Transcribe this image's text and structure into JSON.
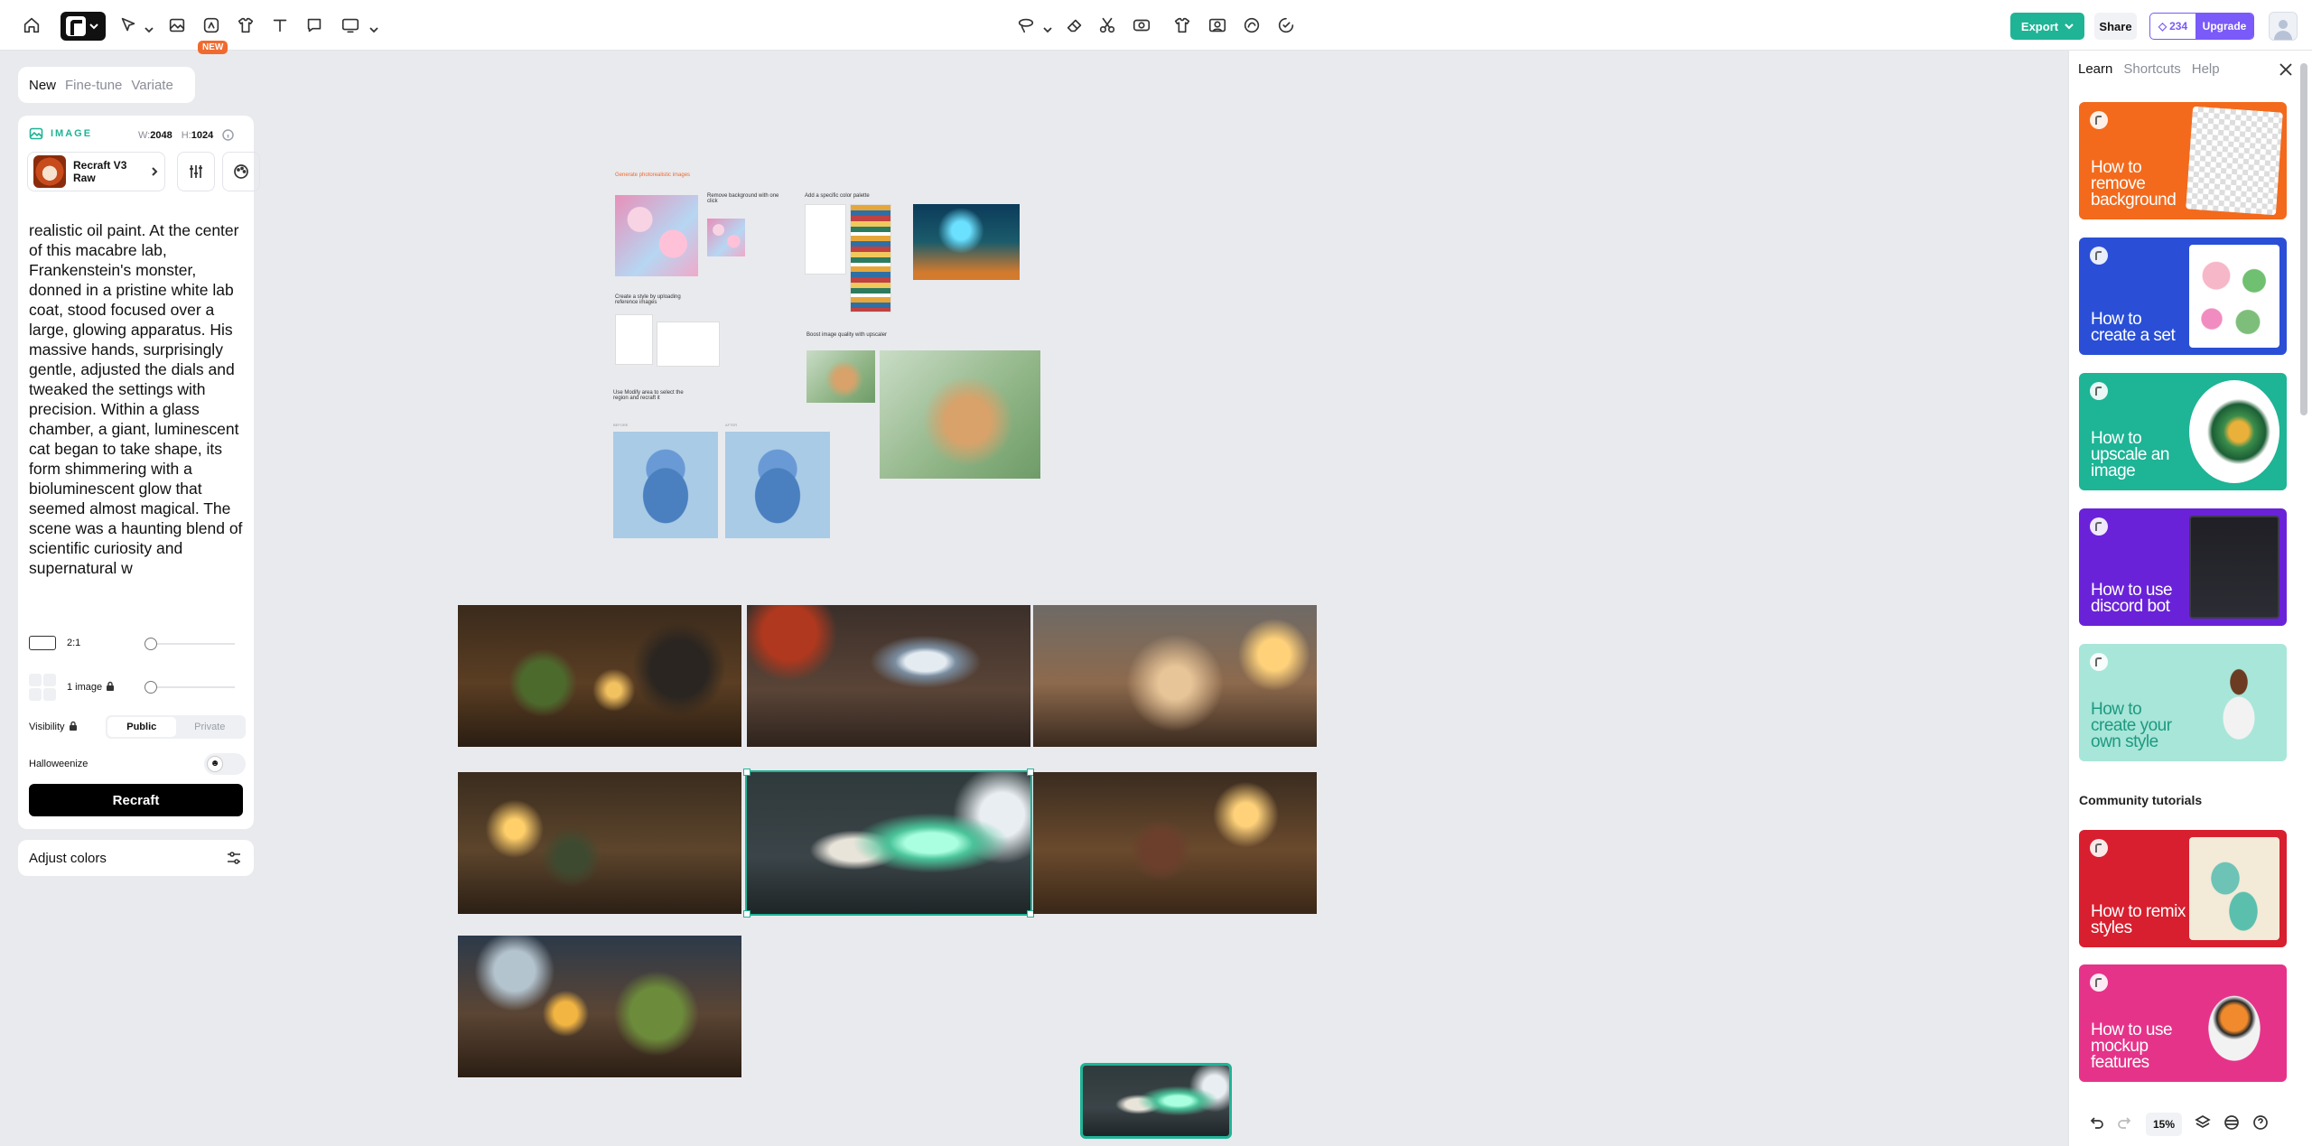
{
  "toolbar": {
    "new_badge": "NEW",
    "export_label": "Export",
    "share_label": "Share",
    "credits": "234",
    "upgrade_label": "Upgrade",
    "left_icons": [
      "home-icon",
      "recraft-logo-menu",
      "select-tool-icon",
      "image-tool-icon",
      "vector-tool-icon",
      "mockup-tool-icon",
      "text-tool-icon",
      "comment-tool-icon",
      "frame-tool-icon"
    ],
    "center_icons": [
      "lasso-icon",
      "eraser-icon",
      "scissors-icon",
      "inpaint-icon",
      "mockup-shirt-icon",
      "remove-background-icon",
      "vectorize-icon",
      "upscale-icon"
    ]
  },
  "left_panel": {
    "tabs": [
      {
        "label": "New",
        "active": true
      },
      {
        "label": "Fine-tune",
        "active": false
      },
      {
        "label": "Variate",
        "active": false
      }
    ],
    "section_label": "IMAGE",
    "width_label": "W:",
    "width_value": "2048",
    "height_label": "H:",
    "height_value": "1024",
    "model_name": "Recraft V3 Raw",
    "prompt": "realistic oil paint. At the center of this macabre lab, Frankenstein's monster, donned in a pristine white lab coat, stood focused over a large, glowing apparatus. His massive hands, surprisingly gentle, adjusted the dials and tweaked the settings with precision. Within a glass chamber, a giant, luminescent cat began to take shape, its form shimmering with a bioluminescent glow that seemed almost magical. The scene was a haunting blend of scientific curiosity and supernatural w",
    "ratio_value": "2:1",
    "count_value": "1 image",
    "visibility_label": "Visibility",
    "visibility_options": [
      "Public",
      "Private"
    ],
    "visibility_selected": "Public",
    "halloweenize_label": "Halloweenize",
    "halloweenize_on": false,
    "generate_label": "Recraft",
    "adjust_colors_label": "Adjust colors"
  },
  "canvas": {
    "board": {
      "title": "Generate photorealistic images",
      "sections": [
        "Remove background with one click",
        "Add a specific color palette",
        "Create a style by uploading reference images",
        "Boost image quality with upscaler",
        "Use Modify area to select the region and recraft it"
      ],
      "before_label": "BEFORE",
      "after_label": "AFTER"
    },
    "images_count": 7,
    "selected_image": 5
  },
  "right_panel": {
    "tabs": [
      {
        "label": "Learn",
        "active": true
      },
      {
        "label": "Shortcuts",
        "active": false
      },
      {
        "label": "Help",
        "active": false
      }
    ],
    "tutorials": [
      {
        "title": "How to remove background",
        "color": "#f36a1c"
      },
      {
        "title": "How to create a set",
        "color": "#2a4fd6"
      },
      {
        "title": "How to upscale an image",
        "color": "#1eb496"
      },
      {
        "title": "How to use discord bot",
        "color": "#6a22d8"
      },
      {
        "title": "How to create your own style",
        "color": "#a8e6d9"
      }
    ],
    "community_title": "Community tutorials",
    "community": [
      {
        "title": "How to remix styles",
        "color": "#d81f2f"
      },
      {
        "title": "How to use mockup features",
        "color": "#e6338a"
      }
    ]
  },
  "bottom_bar": {
    "zoom": "15%"
  }
}
